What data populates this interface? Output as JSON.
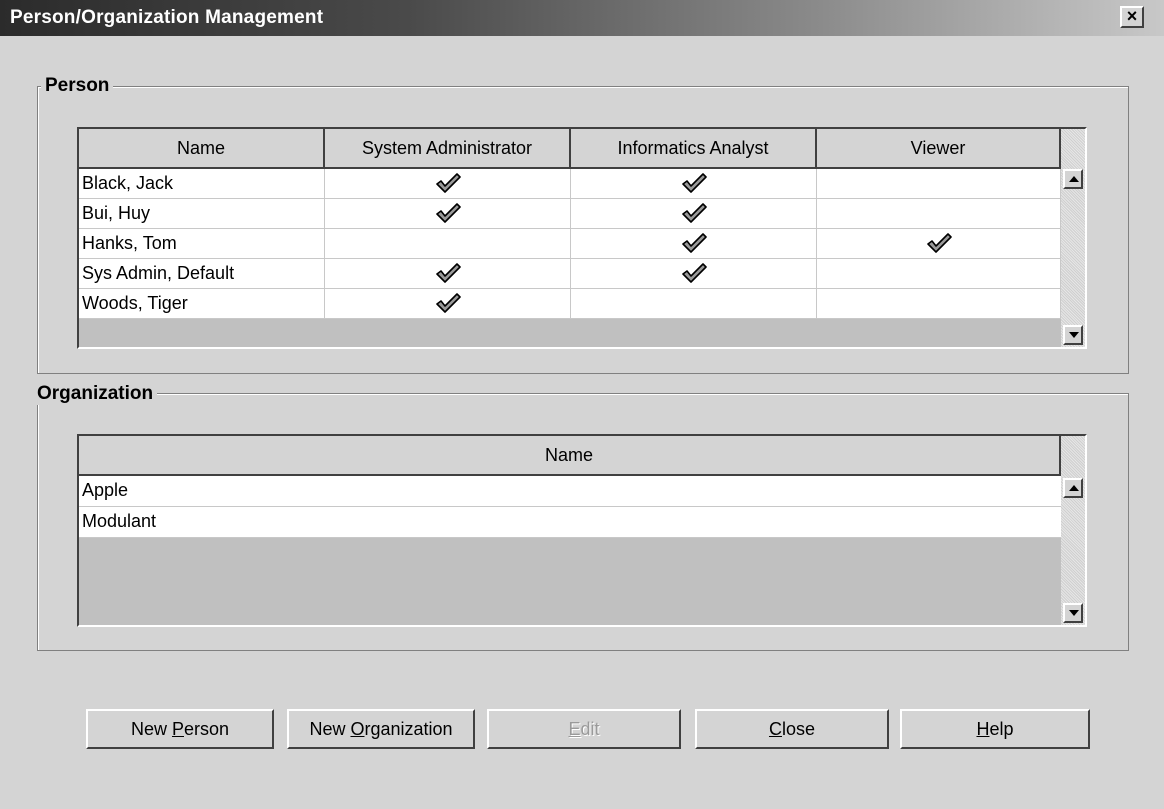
{
  "window": {
    "title": "Person/Organization Management",
    "close_glyph": "✕"
  },
  "person": {
    "label": "Person",
    "columns": [
      "Name",
      "System Administrator",
      "Informatics Analyst",
      "Viewer"
    ],
    "rows": [
      {
        "name": "Black, Jack",
        "sysadmin": true,
        "analyst": true,
        "viewer": false
      },
      {
        "name": "Bui, Huy",
        "sysadmin": true,
        "analyst": true,
        "viewer": false
      },
      {
        "name": "Hanks, Tom",
        "sysadmin": false,
        "analyst": true,
        "viewer": true
      },
      {
        "name": "Sys Admin, Default",
        "sysadmin": true,
        "analyst": true,
        "viewer": false
      },
      {
        "name": "Woods, Tiger",
        "sysadmin": true,
        "analyst": false,
        "viewer": false
      }
    ]
  },
  "organization": {
    "label": "Organization",
    "columns": [
      "Name"
    ],
    "rows": [
      {
        "name": "Apple"
      },
      {
        "name": "Modulant"
      }
    ]
  },
  "buttons": {
    "new_person": {
      "pre": "New ",
      "key": "P",
      "post": "erson",
      "enabled": true
    },
    "new_organization": {
      "pre": "New ",
      "key": "O",
      "post": "rganization",
      "enabled": true
    },
    "edit": {
      "pre": "",
      "key": "E",
      "post": "dit",
      "enabled": false
    },
    "close": {
      "pre": "",
      "key": "C",
      "post": "lose",
      "enabled": true
    },
    "help": {
      "pre": "",
      "key": "H",
      "post": "elp",
      "enabled": true
    }
  },
  "icons": {
    "check": "checkmark-icon",
    "scroll_up": "scroll-up-arrow-icon",
    "scroll_down": "scroll-down-arrow-icon"
  }
}
